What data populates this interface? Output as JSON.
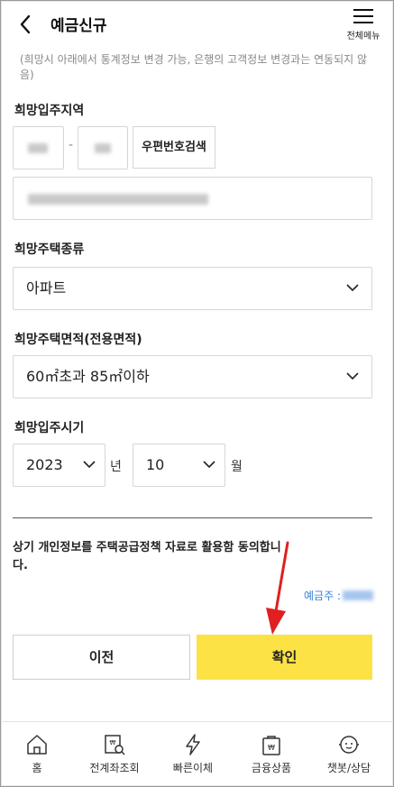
{
  "header": {
    "title": "예금신규",
    "menu_label": "전체메뉴"
  },
  "notice": "(희망시 아래에서 통계정보 변경 가능, 은행의 고객정보 변경과는 연동되지 않음)",
  "region": {
    "label": "희망입주지역",
    "dash": "-",
    "zip_search_label": "우편번호검색"
  },
  "house_type": {
    "label": "희망주택종류",
    "value": "아파트"
  },
  "house_area": {
    "label": "희망주택면적(전용면적)",
    "value": "60㎡초과 85㎡이하"
  },
  "move_in": {
    "label": "희망입주시기",
    "year": "2023",
    "year_unit": "년",
    "month": "10",
    "month_unit": "월"
  },
  "consent": "상기 개인정보를 주택공급정책 자료로 활용함 동의합니다.",
  "depositor_label": "예금주 :",
  "buttons": {
    "prev": "이전",
    "confirm": "확인"
  },
  "tabs": [
    {
      "label": "홈",
      "icon": "home-icon"
    },
    {
      "label": "전계좌조회",
      "icon": "account-search-icon"
    },
    {
      "label": "빠른이체",
      "icon": "lightning-icon"
    },
    {
      "label": "금융상품",
      "icon": "product-bag-icon"
    },
    {
      "label": "챗봇/상담",
      "icon": "chatbot-icon"
    }
  ],
  "colors": {
    "accent": "#fce244",
    "link": "#3a7fd6",
    "annotation_arrow": "#e02020"
  }
}
